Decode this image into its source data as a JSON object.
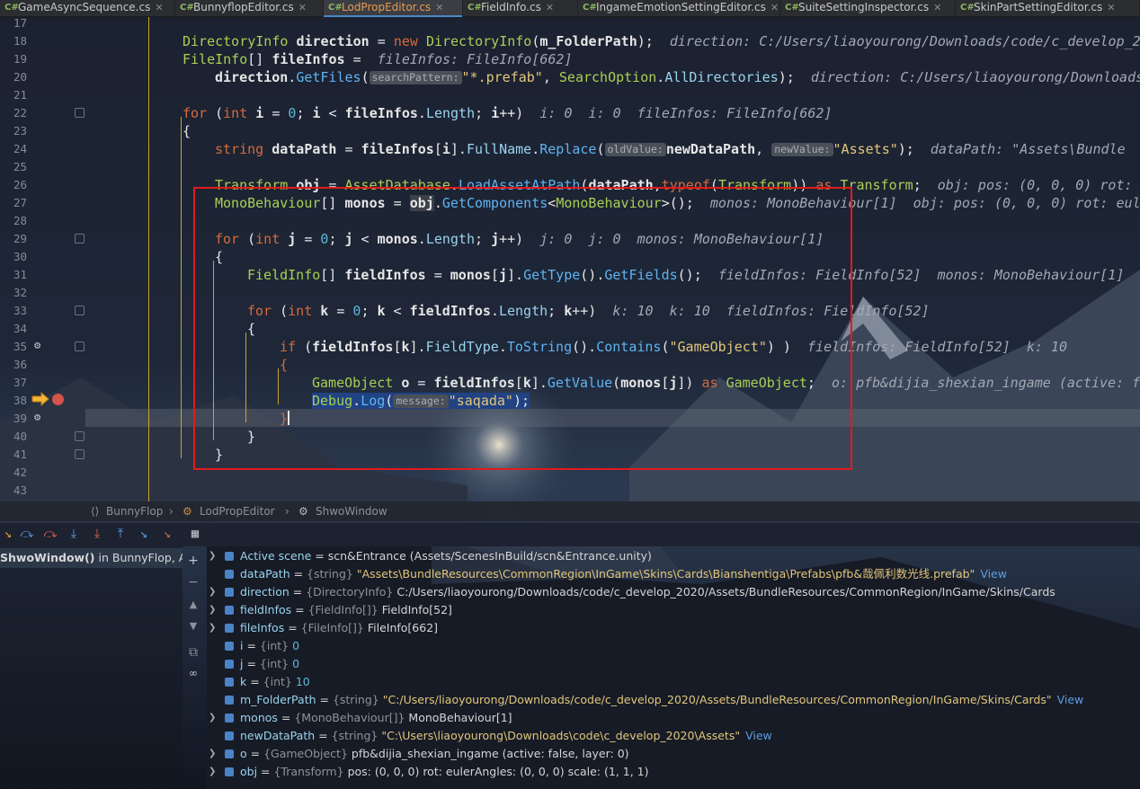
{
  "tabs": [
    {
      "label": "GameAsyncSequence.cs",
      "active": false
    },
    {
      "label": "BunnyflopEditor.cs",
      "active": false
    },
    {
      "label": "LodPropEditor.cs",
      "active": true
    },
    {
      "label": "FieldInfo.cs",
      "active": false
    },
    {
      "label": "IngameEmotionSettingEditor.cs",
      "active": false
    },
    {
      "label": "SuiteSettingInspector.cs",
      "active": false
    },
    {
      "label": "SkinPartSettingEditor.cs",
      "active": false
    }
  ],
  "tab_icon": "C#",
  "line_numbers": [
    "17",
    "18",
    "19",
    "20",
    "21",
    "22",
    "23",
    "24",
    "25",
    "26",
    "27",
    "28",
    "29",
    "30",
    "31",
    "32",
    "33",
    "34",
    "35",
    "36",
    "37",
    "38",
    "39",
    "40",
    "41",
    "42",
    "43"
  ],
  "code": {
    "l18_hint": "direction: C:/Users/liaoyourong/Downloads/code/c_develop_20",
    "l19_hint": "fileInfos: FileInfo[662]",
    "l20_param": "searchPattern:",
    "l20_hint": "direction: C:/Users/liaoyourong/Downloads",
    "l22_hint": "i: 0  i: 0  fileInfos: FileInfo[662]",
    "l24_param1": "oldValue:",
    "l24_param2": "newValue:",
    "l24_hint": "dataPath: \"Assets\\Bundle",
    "l26_hint": "obj: pos: (0, 0, 0) rot: e",
    "l27_hint": "monos: MonoBehaviour[1]  obj: pos: (0, 0, 0) rot: eule",
    "l29_hint": "j: 0  j: 0  monos: MonoBehaviour[1]",
    "l31_hint": "fieldInfos: FieldInfo[52]  monos: MonoBehaviour[1]  f",
    "l33_hint": "k: 10  k: 10  fieldInfos: FieldInfo[52]",
    "l35_hint": "fieldInfos: FieldInfo[52]  k: 10",
    "l37_hint": "o: pfb&dijia_shexian_ingame (active: fa",
    "l38_param": "message:"
  },
  "breadcrumb": [
    "BunnyFlop",
    "LodPropEditor",
    "ShwoWindow"
  ],
  "frame": {
    "method": "ShwoWindow()",
    "suffix": " in BunnyFlop, Asse"
  },
  "debug_toolbar_icons": [
    "show-execution-point-icon",
    "step-over-icon",
    "step-into-icon",
    "force-step-into-icon",
    "step-out-icon",
    "run-to-cursor-icon",
    "evaluate-icon",
    "table-icon"
  ],
  "variables": [
    {
      "name": "Active scene",
      "type": "",
      "value": "scn&Entrance (Assets/ScenesInBuild/scn&Entrance.unity)",
      "expandable": true,
      "icon": "scene",
      "view": ""
    },
    {
      "name": "dataPath",
      "type": "{string}",
      "value": "\"Assets\\BundleResources\\CommonRegion\\InGame\\Skins\\Cards\\Bianshentiga\\Prefabs\\pfb&哉佩利数光线.prefab\"",
      "expandable": false,
      "icon": "field",
      "view": "View",
      "value_kind": "str"
    },
    {
      "name": "direction",
      "type": "{DirectoryInfo}",
      "value": "C:/Users/liaoyourong/Downloads/code/c_develop_2020/Assets/BundleResources/CommonRegion/InGame/Skins/Cards",
      "expandable": true,
      "icon": "field",
      "view": ""
    },
    {
      "name": "fieldInfos",
      "type": "{FieldInfo[]}",
      "value": "FieldInfo[52]",
      "expandable": true,
      "icon": "field",
      "view": ""
    },
    {
      "name": "fileInfos",
      "type": "{FileInfo[]}",
      "value": "FileInfo[662]",
      "expandable": true,
      "icon": "field",
      "view": ""
    },
    {
      "name": "i",
      "type": "{int}",
      "value": "0",
      "expandable": false,
      "icon": "field",
      "view": "",
      "value_kind": "num"
    },
    {
      "name": "j",
      "type": "{int}",
      "value": "0",
      "expandable": false,
      "icon": "field",
      "view": "",
      "value_kind": "num"
    },
    {
      "name": "k",
      "type": "{int}",
      "value": "10",
      "expandable": false,
      "icon": "field",
      "view": "",
      "value_kind": "num"
    },
    {
      "name": "m_FolderPath",
      "type": "{string}",
      "value": "\"C:/Users/liaoyourong/Downloads/code/c_develop_2020/Assets/BundleResources/CommonRegion/InGame/Skins/Cards\"",
      "expandable": false,
      "icon": "field",
      "view": "View",
      "value_kind": "str"
    },
    {
      "name": "monos",
      "type": "{MonoBehaviour[]}",
      "value": "MonoBehaviour[1]",
      "expandable": true,
      "icon": "field",
      "view": ""
    },
    {
      "name": "newDataPath",
      "type": "{string}",
      "value": "\"C:\\Users\\liaoyourong\\Downloads\\code\\c_develop_2020\\Assets\"",
      "expandable": false,
      "icon": "field",
      "view": "View",
      "value_kind": "str"
    },
    {
      "name": "o",
      "type": "{GameObject}",
      "value": "pfb&dijia_shexian_ingame (active: false, layer: 0)",
      "expandable": true,
      "icon": "field",
      "view": ""
    },
    {
      "name": "obj",
      "type": "{Transform}",
      "value": "pos: (0, 0, 0) rot: eulerAngles: (0, 0, 0) scale: (1, 1, 1)",
      "expandable": true,
      "icon": "field",
      "view": ""
    }
  ],
  "colors": {
    "accent": "#4a88c7",
    "annotation_box": "#e21b1b",
    "active_tab": "#e59b52"
  }
}
